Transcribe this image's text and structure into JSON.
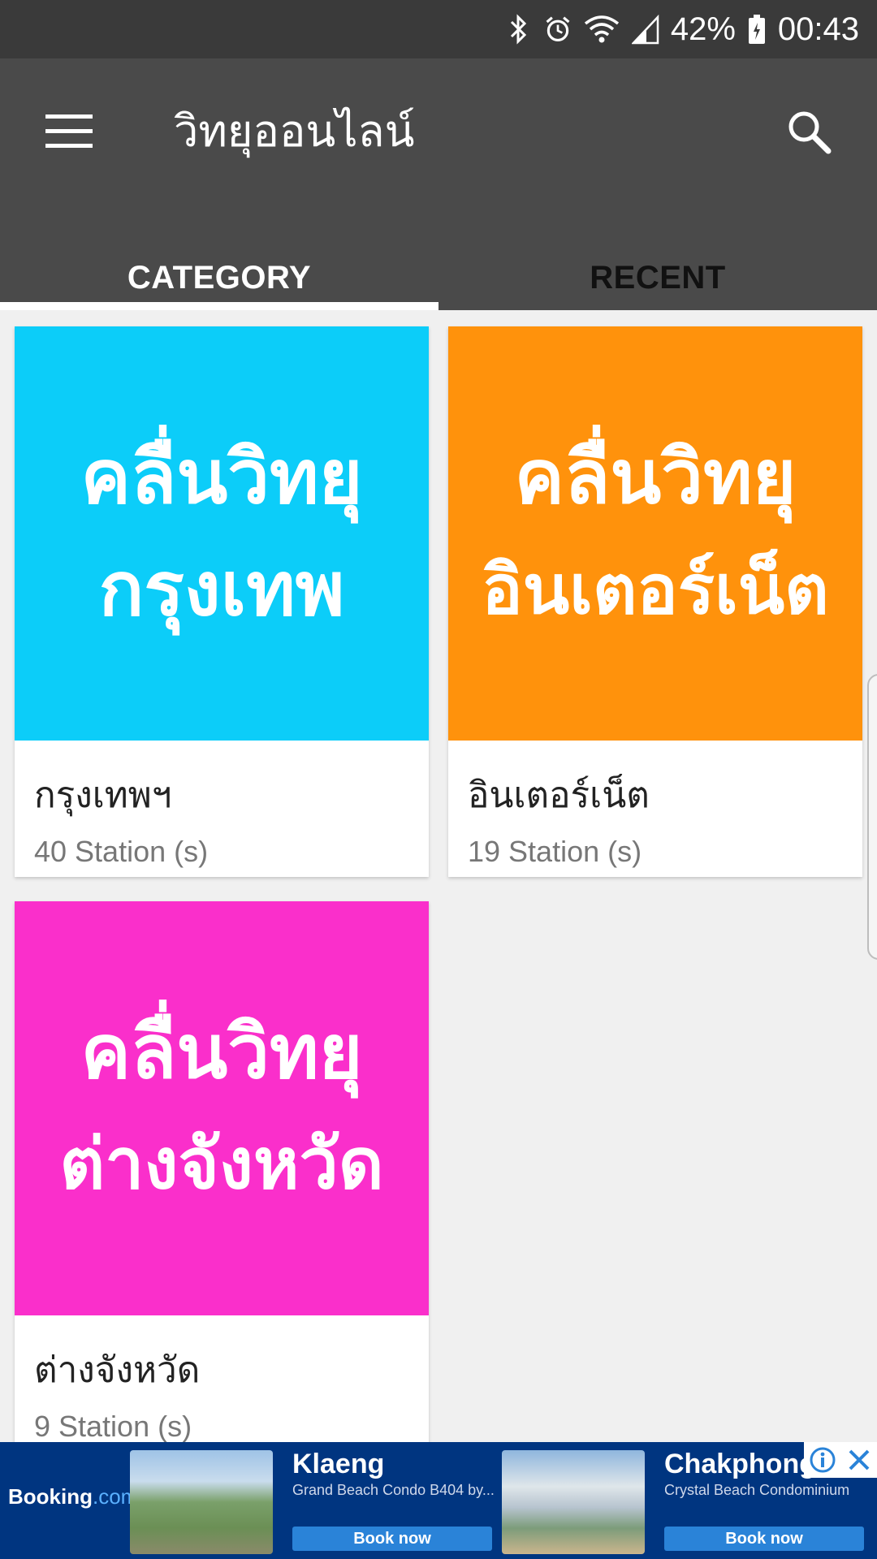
{
  "status_bar": {
    "battery": "42%",
    "time": "00:43",
    "icons": [
      "bluetooth-icon",
      "alarm-icon",
      "wifi-icon",
      "signal-icon",
      "battery-icon"
    ]
  },
  "app_bar": {
    "title": "วิทยุออนไลน์",
    "icons": [
      "menu-icon",
      "search-icon"
    ]
  },
  "tabs": [
    {
      "label": "CATEGORY",
      "active": true
    },
    {
      "label": "RECENT",
      "active": false
    }
  ],
  "categories": [
    {
      "thumb_line1": "คลื่นวิทยุ",
      "thumb_line2": "กรุงเทพ",
      "title": "กรุงเทพฯ",
      "subtitle": "40 Station (s)",
      "color": "#0ccdf9"
    },
    {
      "thumb_line1": "คลื่นวิทยุ",
      "thumb_line2": "อินเตอร์เน็ต",
      "title": "อินเตอร์เน็ต",
      "subtitle": "19 Station (s)",
      "color": "#ff920c"
    },
    {
      "thumb_line1": "คลื่นวิทยุ",
      "thumb_line2": "ต่างจังหวัด",
      "title": "ต่างจังหวัด",
      "subtitle": "9 Station (s)",
      "color": "#fa2fcb"
    }
  ],
  "ad": {
    "brand": "Booking",
    "brand_suffix": ".com",
    "items": [
      {
        "name": "Klaeng",
        "desc": "Grand Beach Condo B404 by...",
        "cta": "Book now"
      },
      {
        "name": "Chakphong",
        "desc": "Crystal Beach Condominium",
        "cta": "Book now"
      }
    ],
    "icons": [
      "info-icon",
      "close-icon"
    ]
  },
  "colors": {
    "status_bar": "#3a3a3a",
    "app_bar": "#4a4a4a",
    "background": "#f0f0f0",
    "ad_background": "#003580"
  }
}
